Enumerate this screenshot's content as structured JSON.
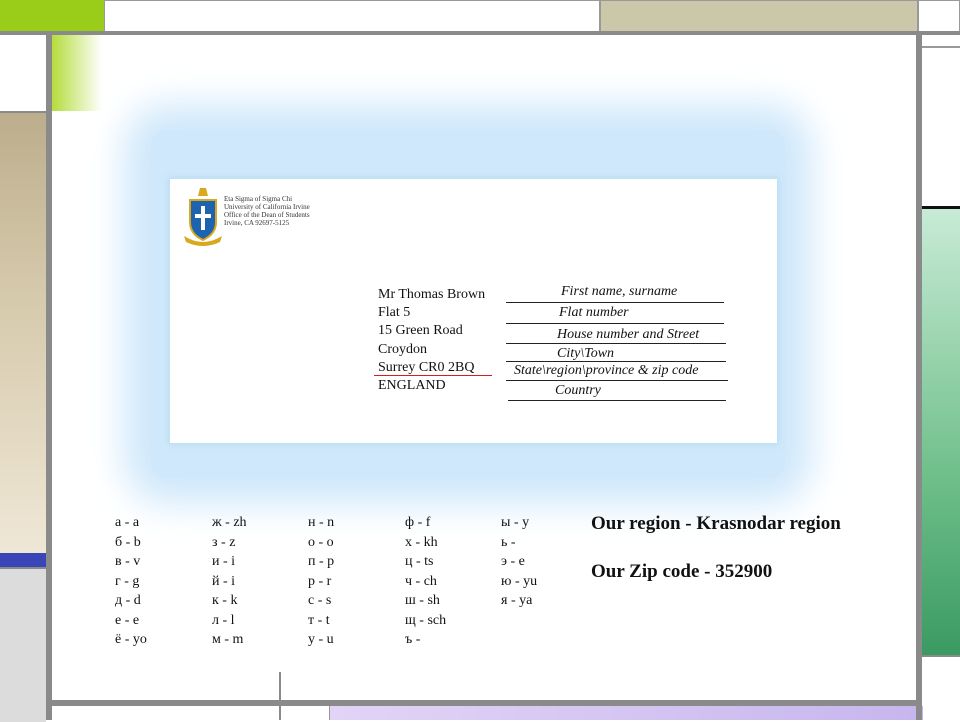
{
  "envelope": {
    "sender": [
      "Eta Sigma of Sigma Chi",
      "University of California Irvine",
      "Office of the Dean of Students",
      "Irvine, CA 92697-5125"
    ],
    "address": [
      "Mr Thomas Brown",
      "Flat 5",
      "15 Green Road",
      "Croydon",
      "Surrey CR0 2BQ",
      "ENGLAND"
    ],
    "fields": [
      "First name, surname",
      "Flat number",
      "House number and Street",
      "City\\Town",
      "State\\region\\province & zip code",
      "Country"
    ]
  },
  "alphabet": {
    "columns": [
      [
        "а - а",
        "б - b",
        "в - v",
        "г - g",
        "д - d",
        "е - e",
        "ё - yo"
      ],
      [
        "ж - zh",
        "з - z",
        "и - i",
        "й - i",
        "к - k",
        "л - l",
        "м - m"
      ],
      [
        "н - n",
        "о - o",
        "п - p",
        "р - r",
        "с - s",
        "т - t",
        "у - u"
      ],
      [
        "ф - f",
        "х - kh",
        "ц - ts",
        "ч - ch",
        "ш - sh",
        "щ - sch",
        "ъ -"
      ],
      [
        "ы - y",
        "ь -",
        "э - e",
        "ю - yu",
        "я - ya"
      ]
    ]
  },
  "info": {
    "region": "Our region - Krasnodar region",
    "zip": "Our Zip code - 352900"
  },
  "colors": {
    "accent_green": "#9acd1a",
    "frame_grey": "#8a8a8a",
    "underline_red": "#d02020"
  }
}
